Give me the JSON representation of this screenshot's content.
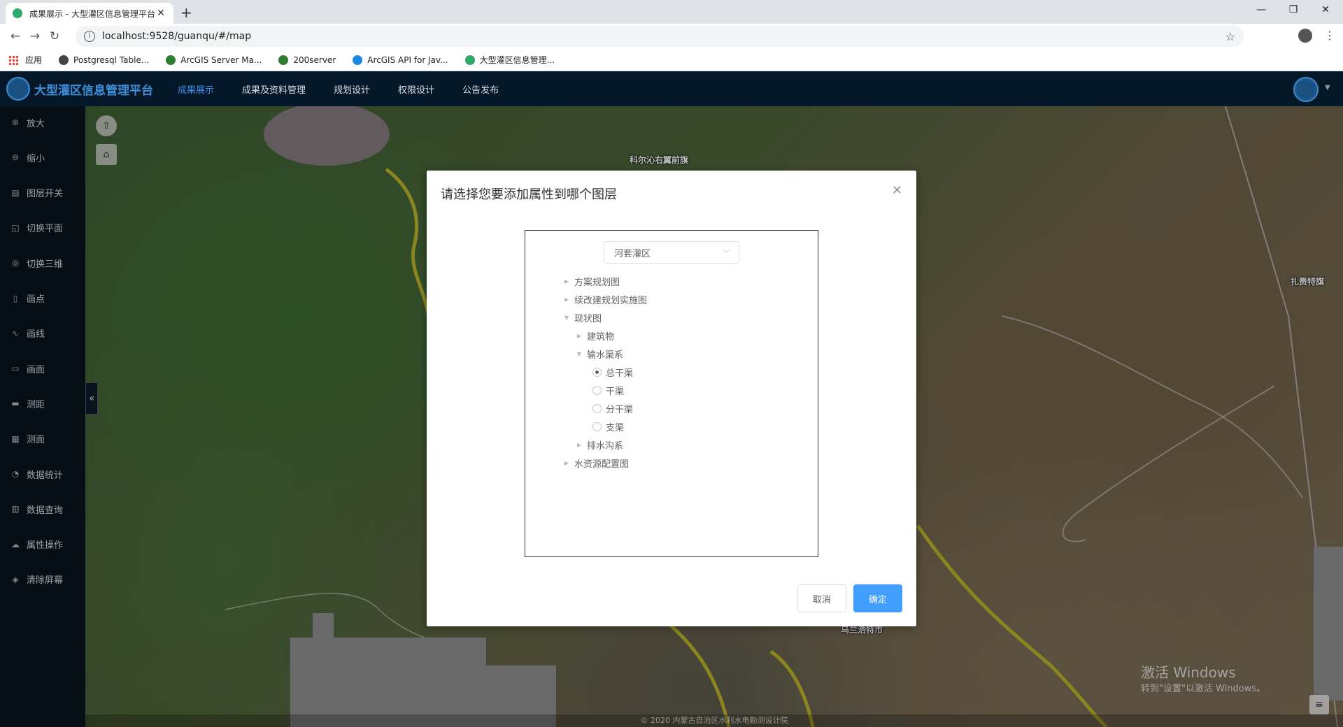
{
  "browser": {
    "tab_title": "成果展示 - 大型灌区信息管理平台",
    "url": "localhost:9528/guanqu/#/map",
    "bookmarks": [
      {
        "label": "应用",
        "color": "#ea4335"
      },
      {
        "label": "Postgresql Table...",
        "color": "#444444"
      },
      {
        "label": "ArcGIS Server Ma...",
        "color": "#2e7d32"
      },
      {
        "label": "200server",
        "color": "#2e7d32"
      },
      {
        "label": "ArcGIS API for Jav...",
        "color": "#1e88e5"
      },
      {
        "label": "大型灌区信息管理...",
        "color": "#2eaa6a"
      }
    ]
  },
  "header": {
    "brand": "大型灌区信息管理平台",
    "nav": [
      "成果展示",
      "成果及资料管理",
      "规划设计",
      "权限设计",
      "公告发布"
    ],
    "active_nav": "成果展示"
  },
  "sidebar": {
    "items": [
      {
        "label": "放大",
        "icon": "zoom-in-icon",
        "glyph": "⊕"
      },
      {
        "label": "缩小",
        "icon": "zoom-out-icon",
        "glyph": "⊖"
      },
      {
        "label": "图层开关",
        "icon": "layers-icon",
        "glyph": "▤"
      },
      {
        "label": "切换平面",
        "icon": "plane-icon",
        "glyph": "◱"
      },
      {
        "label": "切换三维",
        "icon": "globe-icon",
        "glyph": "◎"
      },
      {
        "label": "画点",
        "icon": "point-icon",
        "glyph": "▯"
      },
      {
        "label": "画线",
        "icon": "line-icon",
        "glyph": "∿"
      },
      {
        "label": "画面",
        "icon": "polygon-icon",
        "glyph": "▭"
      },
      {
        "label": "测距",
        "icon": "ruler-icon",
        "glyph": "▬"
      },
      {
        "label": "测面",
        "icon": "area-icon",
        "glyph": "▦"
      },
      {
        "label": "数据统计",
        "icon": "stats-icon",
        "glyph": "◔"
      },
      {
        "label": "数据查询",
        "icon": "query-icon",
        "glyph": "▥"
      },
      {
        "label": "属性操作",
        "icon": "cloud-icon",
        "glyph": "☁"
      },
      {
        "label": "清除屏幕",
        "icon": "eraser-icon",
        "glyph": "◈"
      }
    ]
  },
  "map": {
    "labels": [
      "科尔沁右翼前旗",
      "扎赉特旗",
      "乌兰浩特市"
    ],
    "copyright": "© 2020 内蒙古自治区水利水电勘测设计院",
    "watermark_title": "激活 Windows",
    "watermark_sub": "转到\"设置\"以激活 Windows。"
  },
  "dialog": {
    "title": "请选择您要添加属性到哪个图层",
    "select_value": "河套灌区",
    "tree": [
      {
        "label": "方案规划图",
        "level": 0,
        "type": "collapsed"
      },
      {
        "label": "续改建规划实施图",
        "level": 0,
        "type": "collapsed"
      },
      {
        "label": "现状图",
        "level": 0,
        "type": "expanded"
      },
      {
        "label": "建筑物",
        "level": 1,
        "type": "collapsed"
      },
      {
        "label": "输水渠系",
        "level": 1,
        "type": "expanded"
      },
      {
        "label": "总干渠",
        "level": 2,
        "type": "radio",
        "checked": true
      },
      {
        "label": "干渠",
        "level": 2,
        "type": "radio",
        "checked": false
      },
      {
        "label": "分干渠",
        "level": 2,
        "type": "radio",
        "checked": false
      },
      {
        "label": "支渠",
        "level": 2,
        "type": "radio",
        "checked": false
      },
      {
        "label": "排水沟系",
        "level": 1,
        "type": "collapsed"
      },
      {
        "label": "水资源配置图",
        "level": 0,
        "type": "collapsed"
      }
    ],
    "cancel_label": "取消",
    "ok_label": "确定"
  }
}
